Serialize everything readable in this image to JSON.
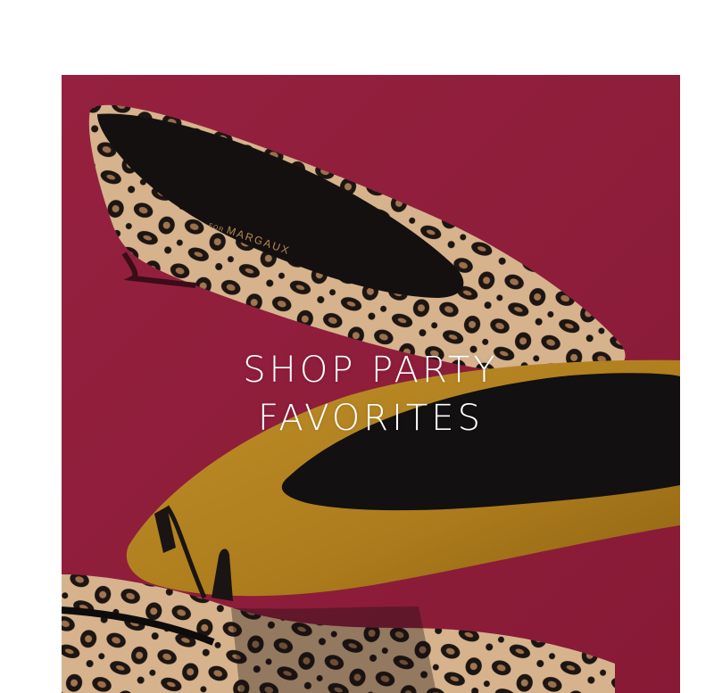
{
  "hero": {
    "headline_line1": "SHOP PARTY",
    "headline_line2": "FAVORITES",
    "brand_stamp_prefix": "FOR",
    "brand_stamp_name": "MARGAUX",
    "background_color": "#8f1d3a"
  },
  "colors": {
    "leopard_base": "#d4b08a",
    "leopard_spot": "#1c1512",
    "mustard": "#b3821f",
    "shoe_interior": "#111111"
  }
}
